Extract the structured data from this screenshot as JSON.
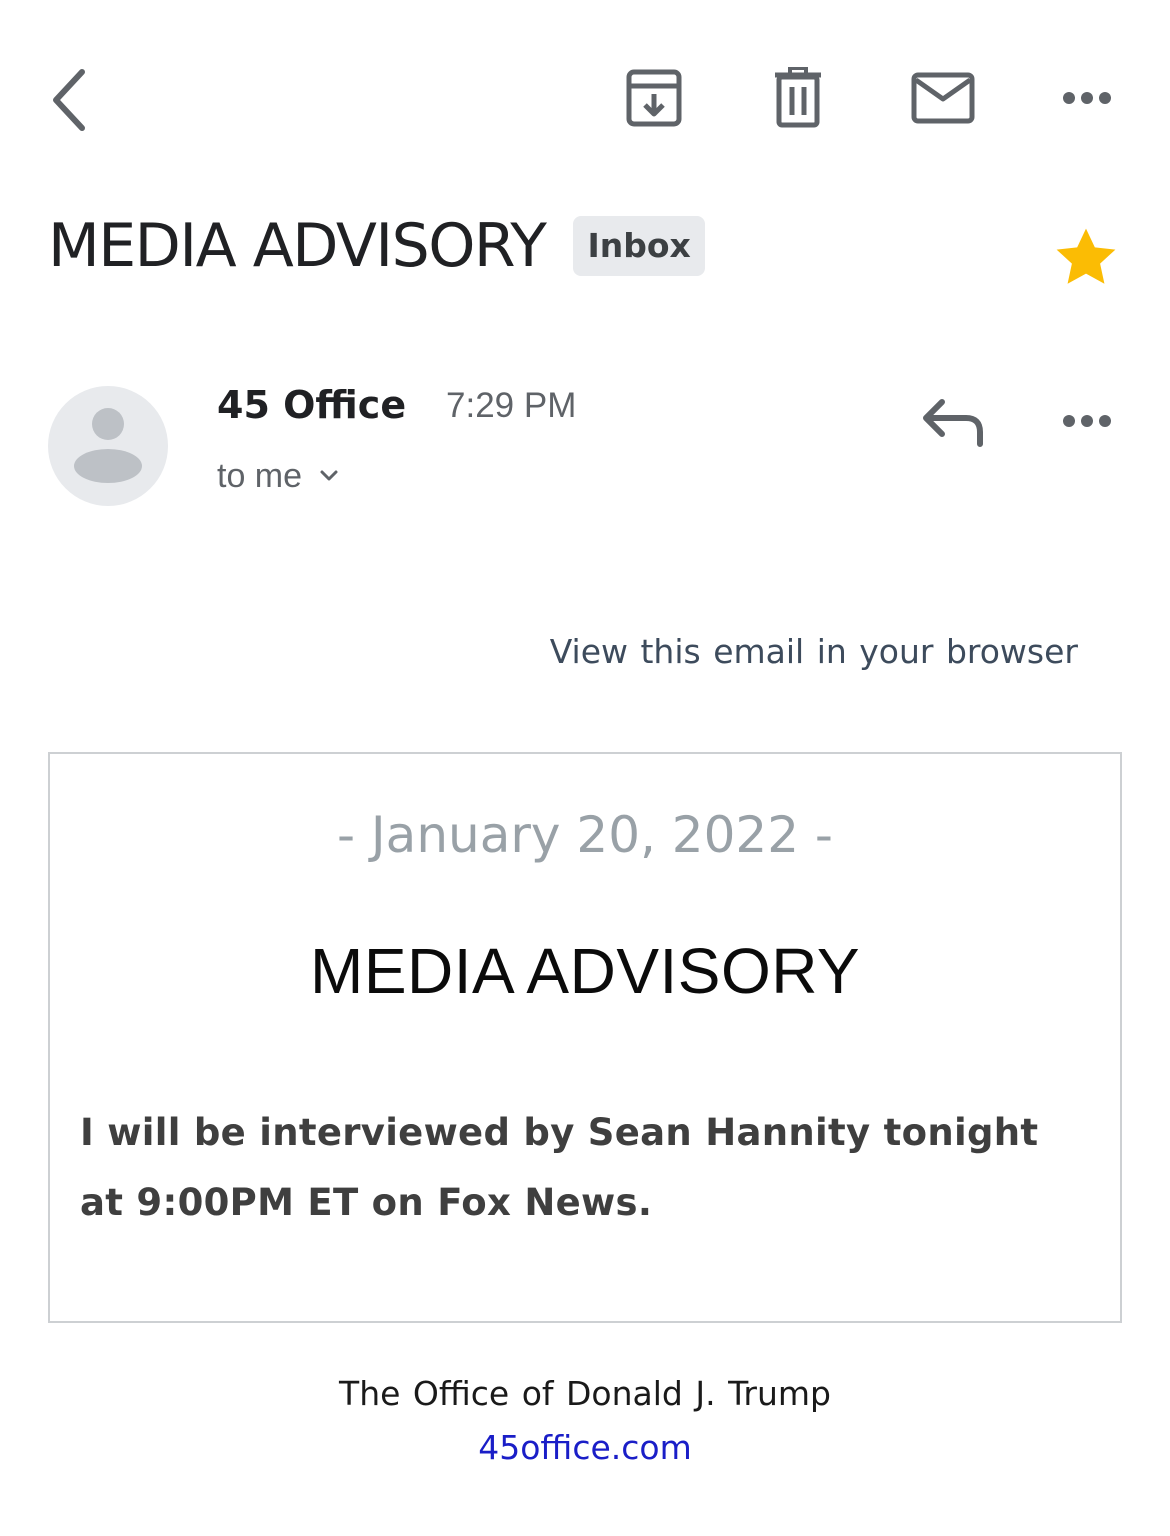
{
  "toolbar": {
    "back_icon": "chevron-left-icon",
    "archive_icon": "archive-icon",
    "delete_icon": "trash-icon",
    "mark_unread_icon": "mail-icon",
    "more_icon": "more-horiz-icon"
  },
  "message": {
    "subject": "MEDIA ADVISORY",
    "label": "Inbox",
    "starred": true,
    "star_color": "#fbbc04",
    "sender_name": "45 Office",
    "time": "7:29 PM",
    "recipient": "to me"
  },
  "body": {
    "view_in_browser": "View this email in your browser",
    "date": "- January 20, 2022 -",
    "title": "MEDIA ADVISORY",
    "text": "I will be interviewed by Sean Hannity tonight at 9:00PM ET on Fox News.",
    "footer_org": "The Office of Donald J. Trump",
    "footer_link": "45office.com",
    "link_color": "#1a1ec7"
  }
}
